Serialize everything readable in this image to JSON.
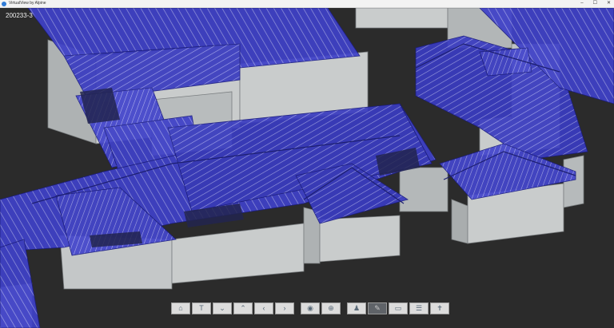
{
  "window": {
    "title": "VirtualView by Alpine",
    "controls": [
      "–",
      "☐",
      "✕"
    ]
  },
  "viewport": {
    "project_label": "200233-3"
  },
  "toolbar": {
    "buttons": [
      {
        "icon": "home-icon",
        "glyph": "⌂"
      },
      {
        "icon": "top-view-icon",
        "glyph": "T"
      },
      {
        "icon": "chevron-down-icon",
        "glyph": "⌄"
      },
      {
        "icon": "chevron-up-icon",
        "glyph": "⌃"
      },
      {
        "icon": "chevron-left-icon",
        "glyph": "‹"
      },
      {
        "icon": "chevron-right-icon",
        "glyph": "›"
      },
      {
        "icon": "eye-icon",
        "glyph": "◉"
      },
      {
        "icon": "zoom-icon",
        "glyph": "⊕"
      },
      {
        "icon": "person-icon",
        "glyph": "♟"
      },
      {
        "icon": "edit-icon",
        "glyph": "✎"
      },
      {
        "icon": "measure-icon",
        "glyph": "▭"
      },
      {
        "icon": "layers-icon",
        "glyph": "☰"
      },
      {
        "icon": "walk-icon",
        "glyph": "✝"
      }
    ]
  },
  "colors": {
    "background": "#2b2b2b",
    "wall": "#c9cccc",
    "roof": "#3b3dc0"
  }
}
